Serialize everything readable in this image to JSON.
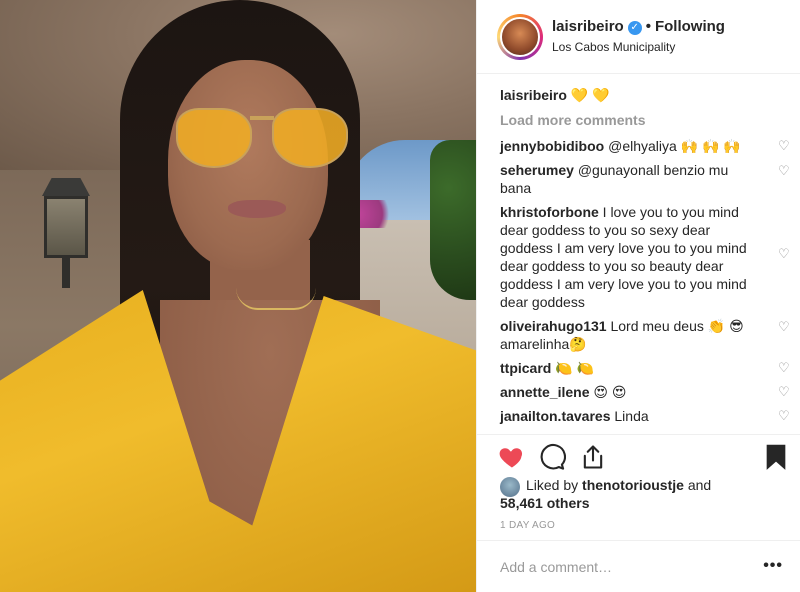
{
  "post": {
    "photo_alt": "",
    "header": {
      "username": "laisribeiro",
      "verified": true,
      "separator": "•",
      "follow_status": "Following",
      "location": "Los Cabos Municipality"
    },
    "caption": {
      "username": "laisribeiro",
      "text": "💛 💛"
    },
    "load_more": "Load more comments",
    "comments": [
      {
        "username": "jennybobidiboo",
        "text": "@elhyaliya 🙌 🙌 🙌"
      },
      {
        "username": "seherumey",
        "text": "@gunayonall benzio mu bana"
      },
      {
        "username": "khristoforbone",
        "text": "I love you to you mind dear goddess to you so sexy dear goddess I am very love you to you mind dear goddess to you so beauty dear goddess I am very love you to you mind dear goddess"
      },
      {
        "username": "oliveirahugo131",
        "text": "Lord meu deus 👏 😎 amarelinha🤔"
      },
      {
        "username": "ttpicard",
        "text": "🍋 🍋"
      },
      {
        "username": "annette_ilene",
        "text": "😍 😍"
      },
      {
        "username": "janailton.tavares",
        "text": "Linda"
      }
    ],
    "likes": {
      "prefix": "Liked by",
      "user": "thenotorioustje",
      "conj": "and",
      "others": "58,461 others"
    },
    "timestamp": "1 DAY AGO",
    "add_comment_placeholder": "Add a comment…",
    "more_label": "•••",
    "colors": {
      "like_red": "#ed4956",
      "verified_blue": "#3897f0",
      "muted_gray": "#999999"
    },
    "icons": [
      "heart-icon",
      "comment-icon",
      "share-icon",
      "bookmark-icon",
      "verified-icon",
      "comment-heart-icon"
    ]
  }
}
